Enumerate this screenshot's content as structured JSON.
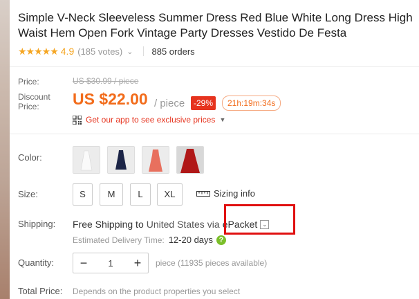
{
  "product": {
    "title": "Simple V-Neck Sleeveless Summer Dress Red Blue White Long Dress High Waist Hem Open Fork Vintage Party Dresses Vestido De Festa",
    "rating_stars": "★★★★★",
    "rating": "4.9",
    "votes": "(185 votes)",
    "orders": "885 orders"
  },
  "price": {
    "price_label": "Price:",
    "old_price": "US $30.99 / piece",
    "discount_label": "Discount Price:",
    "new_price": "US $22.00",
    "per_piece": "/ piece",
    "discount_badge": "-29%",
    "countdown": "21h:19m:34s",
    "app_promo": "Get our app to see exclusive prices"
  },
  "options": {
    "color_label": "Color:",
    "colors": [
      {
        "name": "white",
        "hex": "#f4f4f4"
      },
      {
        "name": "navy",
        "hex": "#1c2547"
      },
      {
        "name": "coral",
        "hex": "#e8705e"
      },
      {
        "name": "red",
        "hex": "#b01818"
      }
    ],
    "size_label": "Size:",
    "sizes": [
      "S",
      "M",
      "L",
      "XL"
    ],
    "sizing_info": "Sizing info"
  },
  "shipping": {
    "label": "Shipping:",
    "free": "Free Shipping to",
    "country": "United States",
    "via": "via",
    "method": "ePacket",
    "delivery_label": "Estimated Delivery Time:",
    "delivery_days": "12-20 days"
  },
  "quantity": {
    "label": "Quantity:",
    "value": "1",
    "minus": "−",
    "plus": "+",
    "note": "piece (11935 pieces available)"
  },
  "total": {
    "label": "Total Price:",
    "note": "Depends on the product properties you select"
  },
  "colors": {
    "accent": "#f26c1b",
    "discount_bg": "#e6331e",
    "star": "#f5a623",
    "highlight": "#e01010"
  }
}
